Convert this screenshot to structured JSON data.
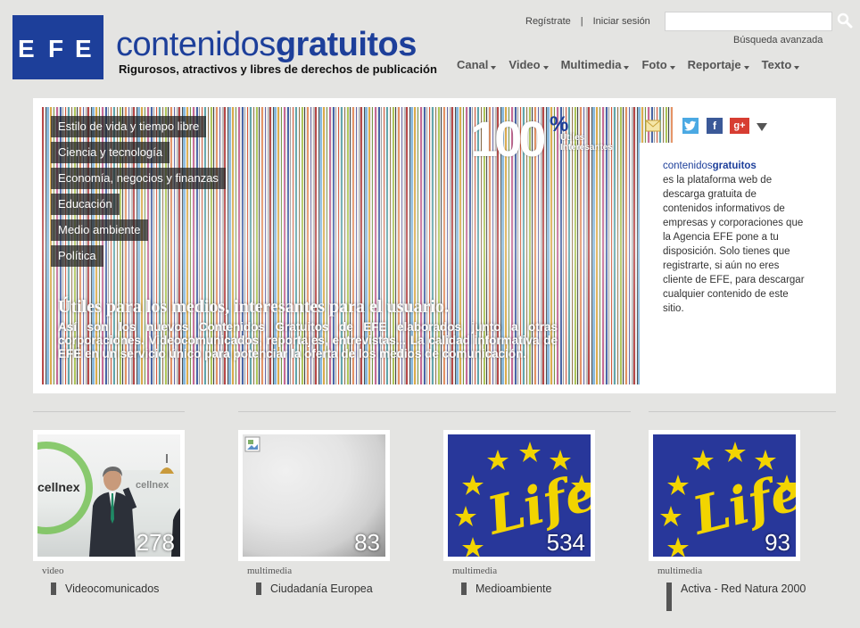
{
  "header": {
    "logo_text": "EFE",
    "brand_light": "contenidos",
    "brand_bold": "gratuitos",
    "tagline": "Rigurosos, atractivos y libres de derechos de publicación",
    "register_label": "Regístrate",
    "separator": "|",
    "login_label": "Iniciar sesión",
    "search_placeholder": "",
    "advanced_search_label": "Búsqueda avanzada"
  },
  "nav": [
    {
      "label": "Canal"
    },
    {
      "label": "Video"
    },
    {
      "label": "Multimedia"
    },
    {
      "label": "Foto"
    },
    {
      "label": "Reportaje"
    },
    {
      "label": "Texto"
    }
  ],
  "hero": {
    "categories": [
      "Estilo de vida y tiempo libre",
      "Ciencia y tecnología",
      "Economía, negocios y finanzas",
      "Educación",
      "Medio ambiente",
      "Política"
    ],
    "badge_number": "100",
    "badge_percent": "%",
    "badge_line1": "Útiles",
    "badge_line2": "Interesantes",
    "title": "Útiles para los medios, interesantes para el usuario.",
    "text": "Así son los nuevos Contenidos Gratuitos de EFE elaborados junto a otras corporaciones. Videocomunicados, reportajes, entrevistas... La calidad informativa de EFE en un servicio único para potenciar la oferta de los medios de comunicación."
  },
  "social": {
    "icons": [
      "email-icon",
      "twitter-icon",
      "facebook-icon",
      "google-plus-icon",
      "chevron-down-icon"
    ],
    "colors": {
      "twitter": "#4ba9e3",
      "facebook": "#3b5998",
      "google": "#d73d32"
    }
  },
  "info": {
    "brand_light": "contenidos",
    "brand_bold": "gratuitos",
    "text": "es la plataforma web de descarga gratuita de contenidos informativos de empresas y corporaciones que la Agencia EFE pone a tu disposición. Solo tienes que registrarte, si aún no eres cliente de EFE, para descargar cualquier contenido de este sitio."
  },
  "tiles": [
    {
      "type": "video",
      "count": "278",
      "label": "Videocomunicados"
    },
    {
      "type": "multimedia",
      "count": "83",
      "label": "Ciudadanía Europea"
    },
    {
      "type": "multimedia",
      "count": "534",
      "label": "Medioambiente"
    },
    {
      "type": "multimedia",
      "count": "93",
      "label": "Activa - Red Natura 2000"
    }
  ],
  "tile_images": {
    "cellnex_text": "cellnex",
    "life_text": "Life"
  },
  "colors": {
    "brand_blue": "#1d3f9a",
    "eu_blue": "#28379a",
    "eu_star": "#f2d400"
  }
}
